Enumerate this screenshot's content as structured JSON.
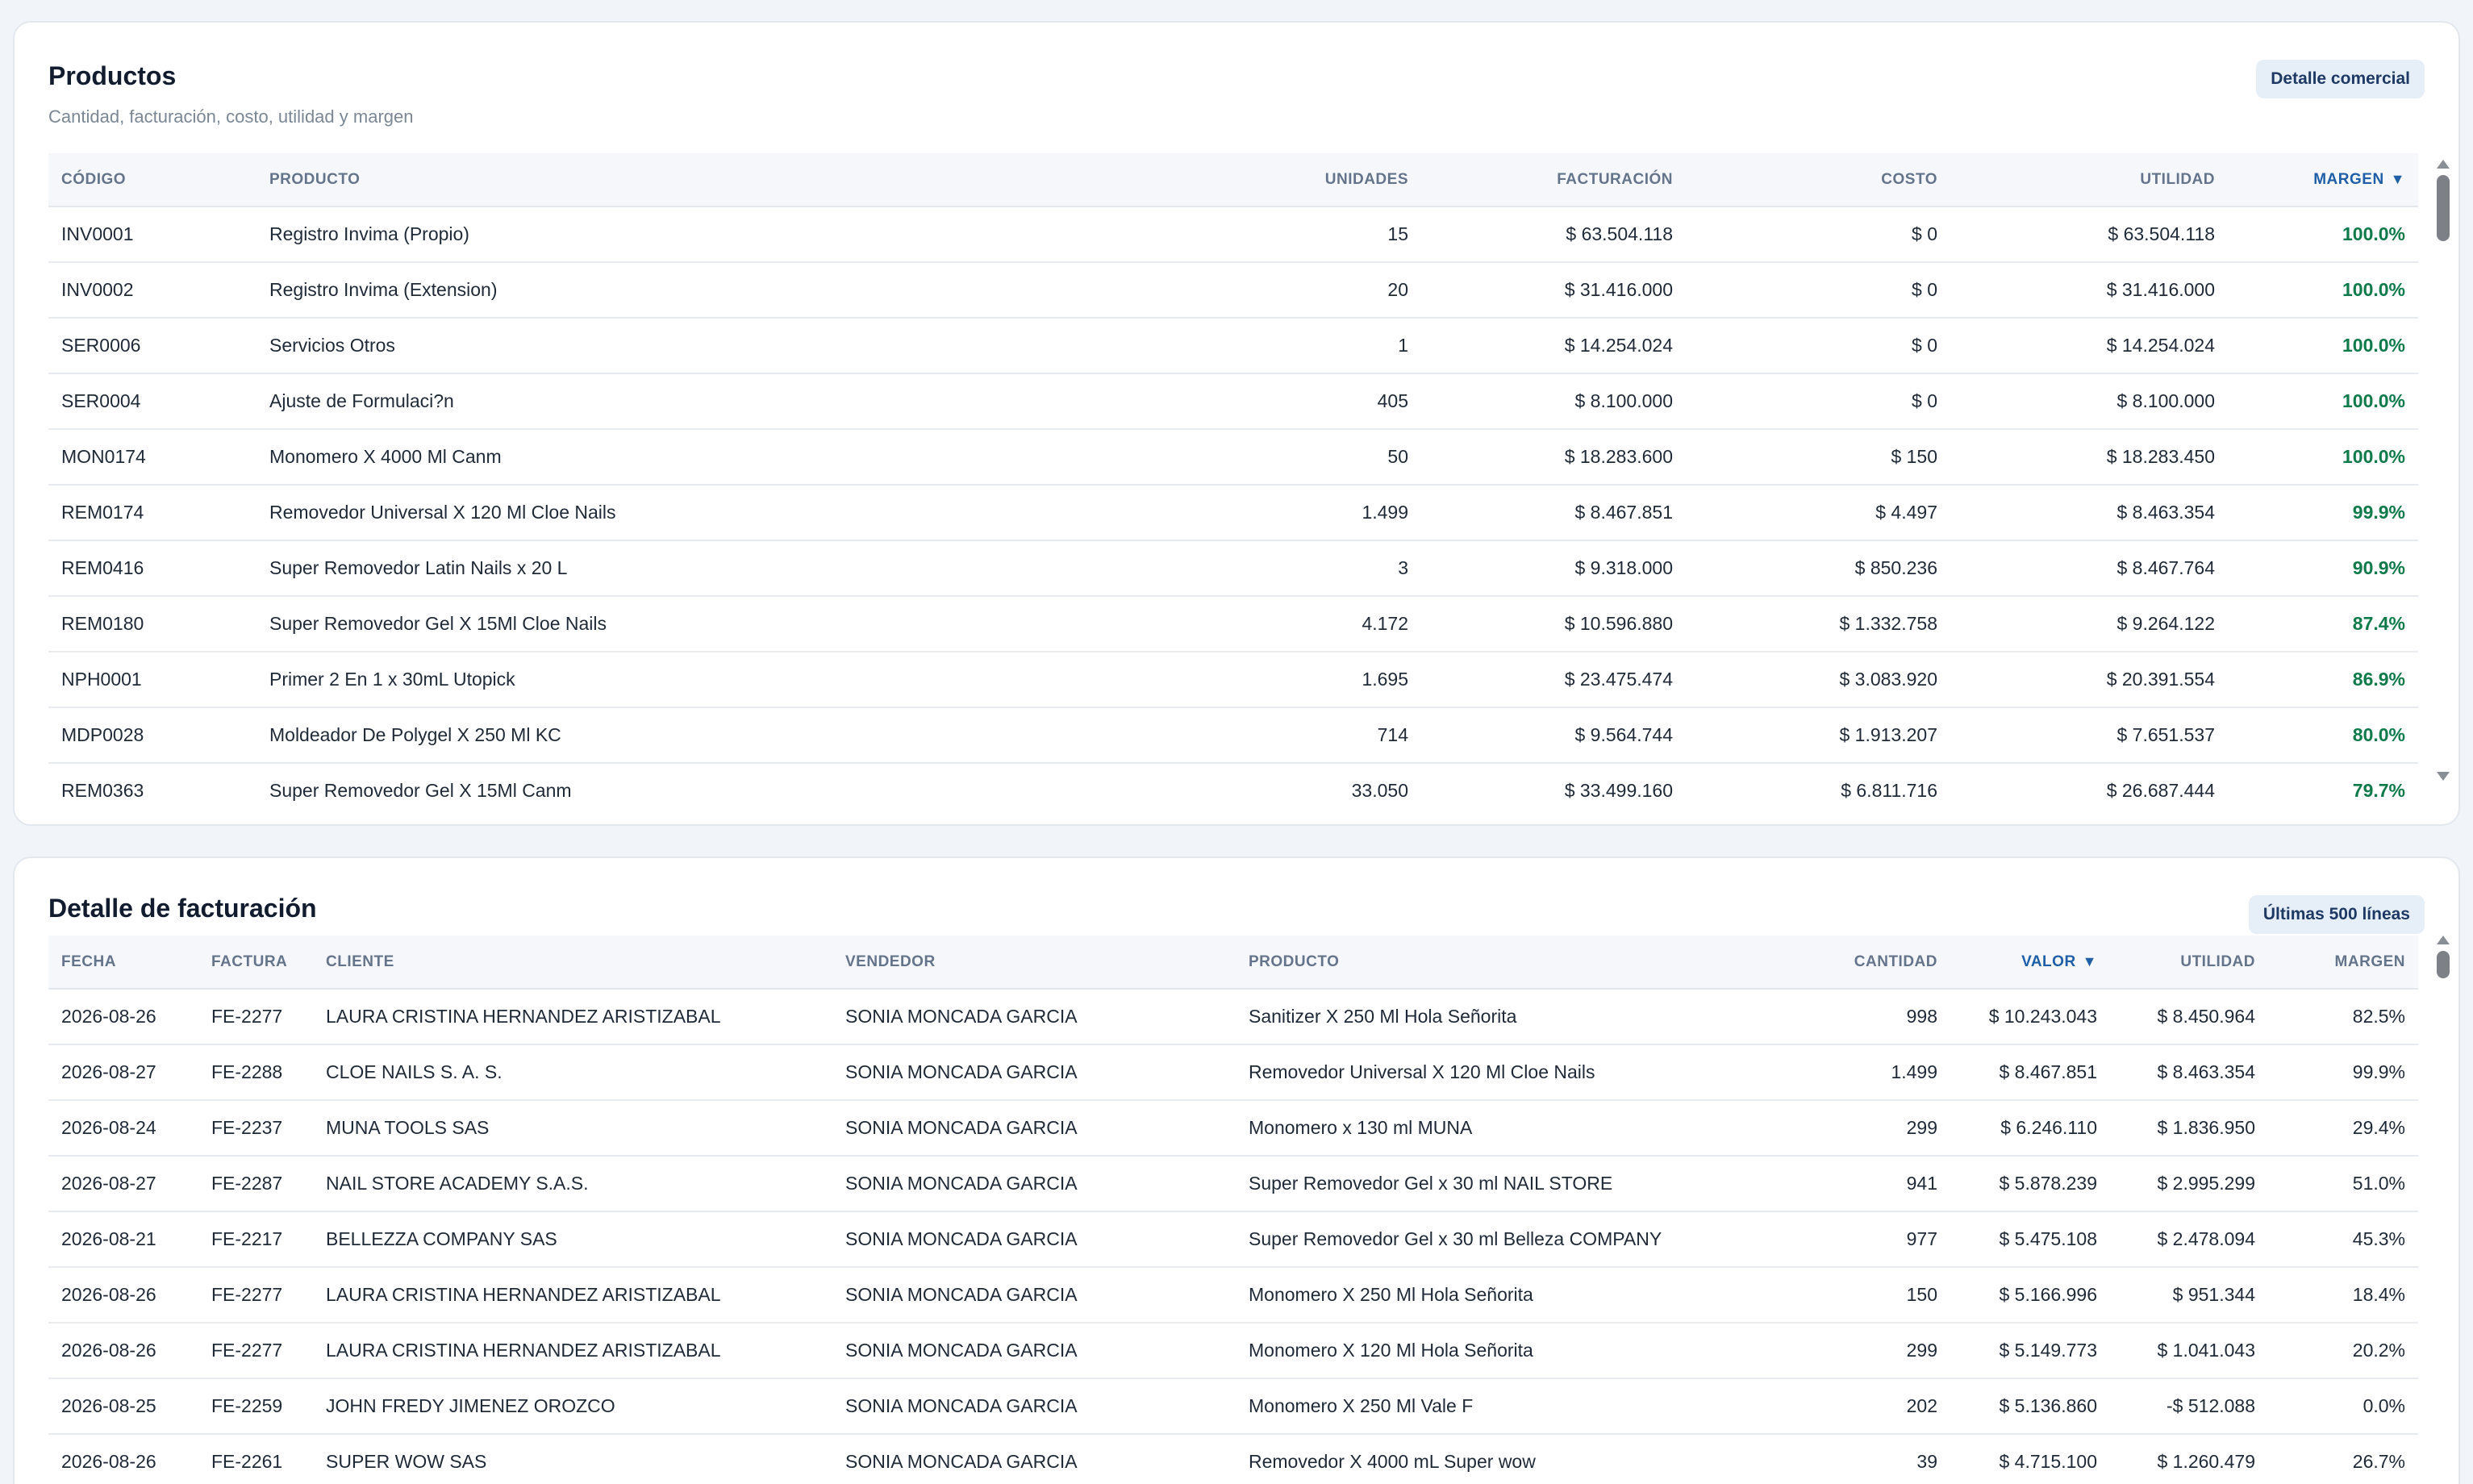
{
  "products_card": {
    "title": "Productos",
    "subtitle": "Cantidad, facturación, costo, utilidad y margen",
    "badge": "Detalle comercial",
    "columns": {
      "code": "CÓDIGO",
      "product": "PRODUCTO",
      "units": "UNIDADES",
      "billing": "FACTURACIÓN",
      "cost": "COSTO",
      "profit": "UTILIDAD",
      "margin": "MARGEN"
    },
    "rows": [
      {
        "code": "INV0001",
        "product": "Registro Invima (Propio)",
        "units": "15",
        "billing": "$ 63.504.118",
        "cost": "$ 0",
        "profit": "$ 63.504.118",
        "margin": "100.0%"
      },
      {
        "code": "INV0002",
        "product": "Registro Invima (Extension)",
        "units": "20",
        "billing": "$ 31.416.000",
        "cost": "$ 0",
        "profit": "$ 31.416.000",
        "margin": "100.0%"
      },
      {
        "code": "SER0006",
        "product": "Servicios Otros",
        "units": "1",
        "billing": "$ 14.254.024",
        "cost": "$ 0",
        "profit": "$ 14.254.024",
        "margin": "100.0%"
      },
      {
        "code": "SER0004",
        "product": "Ajuste de Formulaci?n",
        "units": "405",
        "billing": "$ 8.100.000",
        "cost": "$ 0",
        "profit": "$ 8.100.000",
        "margin": "100.0%"
      },
      {
        "code": "MON0174",
        "product": "Monomero X 4000 Ml Canm",
        "units": "50",
        "billing": "$ 18.283.600",
        "cost": "$ 150",
        "profit": "$ 18.283.450",
        "margin": "100.0%"
      },
      {
        "code": "REM0174",
        "product": "Removedor Universal X 120 Ml Cloe Nails",
        "units": "1.499",
        "billing": "$ 8.467.851",
        "cost": "$ 4.497",
        "profit": "$ 8.463.354",
        "margin": "99.9%"
      },
      {
        "code": "REM0416",
        "product": "Super Removedor Latin Nails x 20 L",
        "units": "3",
        "billing": "$ 9.318.000",
        "cost": "$ 850.236",
        "profit": "$ 8.467.764",
        "margin": "90.9%"
      },
      {
        "code": "REM0180",
        "product": "Super Removedor Gel X 15Ml Cloe Nails",
        "units": "4.172",
        "billing": "$ 10.596.880",
        "cost": "$ 1.332.758",
        "profit": "$ 9.264.122",
        "margin": "87.4%"
      },
      {
        "code": "NPH0001",
        "product": "Primer 2 En 1 x 30mL Utopick",
        "units": "1.695",
        "billing": "$ 23.475.474",
        "cost": "$ 3.083.920",
        "profit": "$ 20.391.554",
        "margin": "86.9%"
      },
      {
        "code": "MDP0028",
        "product": "Moldeador De Polygel X 250 Ml KC",
        "units": "714",
        "billing": "$ 9.564.744",
        "cost": "$ 1.913.207",
        "profit": "$ 7.651.537",
        "margin": "80.0%"
      },
      {
        "code": "REM0363",
        "product": "Super Removedor Gel X 15Ml Canm",
        "units": "33.050",
        "billing": "$ 33.499.160",
        "cost": "$ 6.811.716",
        "profit": "$ 26.687.444",
        "margin": "79.7%"
      }
    ]
  },
  "billing_card": {
    "title": "Detalle de facturación",
    "badge": "Últimas 500 líneas",
    "columns": {
      "date": "FECHA",
      "invoice": "FACTURA",
      "client": "CLIENTE",
      "seller": "VENDEDOR",
      "product": "PRODUCTO",
      "qty": "CANTIDAD",
      "value": "VALOR",
      "profit": "UTILIDAD",
      "margin": "MARGEN"
    },
    "rows": [
      {
        "date": "2026-08-26",
        "invoice": "FE-2277",
        "client": "LAURA CRISTINA HERNANDEZ ARISTIZABAL",
        "seller": "SONIA MONCADA GARCIA",
        "product": "Sanitizer X 250 Ml Hola Señorita",
        "qty": "998",
        "value": "$ 10.243.043",
        "profit": "$ 8.450.964",
        "margin": "82.5%"
      },
      {
        "date": "2026-08-27",
        "invoice": "FE-2288",
        "client": "CLOE NAILS S. A. S.",
        "seller": "SONIA MONCADA GARCIA",
        "product": "Removedor Universal X 120 Ml Cloe Nails",
        "qty": "1.499",
        "value": "$ 8.467.851",
        "profit": "$ 8.463.354",
        "margin": "99.9%"
      },
      {
        "date": "2026-08-24",
        "invoice": "FE-2237",
        "client": "MUNA TOOLS SAS",
        "seller": "SONIA MONCADA GARCIA",
        "product": "Monomero x 130 ml MUNA",
        "qty": "299",
        "value": "$ 6.246.110",
        "profit": "$ 1.836.950",
        "margin": "29.4%"
      },
      {
        "date": "2026-08-27",
        "invoice": "FE-2287",
        "client": "NAIL STORE ACADEMY S.A.S.",
        "seller": "SONIA MONCADA GARCIA",
        "product": "Super Removedor Gel x 30 ml NAIL STORE",
        "qty": "941",
        "value": "$ 5.878.239",
        "profit": "$ 2.995.299",
        "margin": "51.0%"
      },
      {
        "date": "2026-08-21",
        "invoice": "FE-2217",
        "client": "BELLEZZA COMPANY SAS",
        "seller": "SONIA MONCADA GARCIA",
        "product": "Super Removedor Gel x 30 ml Belleza COMPANY",
        "qty": "977",
        "value": "$ 5.475.108",
        "profit": "$ 2.478.094",
        "margin": "45.3%"
      },
      {
        "date": "2026-08-26",
        "invoice": "FE-2277",
        "client": "LAURA CRISTINA HERNANDEZ ARISTIZABAL",
        "seller": "SONIA MONCADA GARCIA",
        "product": "Monomero X 250 Ml Hola Señorita",
        "qty": "150",
        "value": "$ 5.166.996",
        "profit": "$ 951.344",
        "margin": "18.4%"
      },
      {
        "date": "2026-08-26",
        "invoice": "FE-2277",
        "client": "LAURA CRISTINA HERNANDEZ ARISTIZABAL",
        "seller": "SONIA MONCADA GARCIA",
        "product": "Monomero X 120 Ml Hola Señorita",
        "qty": "299",
        "value": "$ 5.149.773",
        "profit": "$ 1.041.043",
        "margin": "20.2%"
      },
      {
        "date": "2026-08-25",
        "invoice": "FE-2259",
        "client": "JOHN FREDY JIMENEZ OROZCO",
        "seller": "SONIA MONCADA GARCIA",
        "product": "Monomero X 250 Ml Vale F",
        "qty": "202",
        "value": "$ 5.136.860",
        "profit": "-$ 512.088",
        "margin": "0.0%"
      },
      {
        "date": "2026-08-26",
        "invoice": "FE-2261",
        "client": "SUPER WOW SAS",
        "seller": "SONIA MONCADA GARCIA",
        "product": "Removedor X 4000 mL Super wow",
        "qty": "39",
        "value": "$ 4.715.100",
        "profit": "$ 1.260.479",
        "margin": "26.7%"
      }
    ]
  },
  "colors": {
    "accent": "#1f5fa8",
    "positive_margin": "#0f7a4a",
    "badge_bg": "#e6eef8"
  },
  "icons": {
    "sort": "sort-desc-icon",
    "scroll_up": "scroll-up-icon",
    "scroll_down": "scroll-down-icon"
  }
}
